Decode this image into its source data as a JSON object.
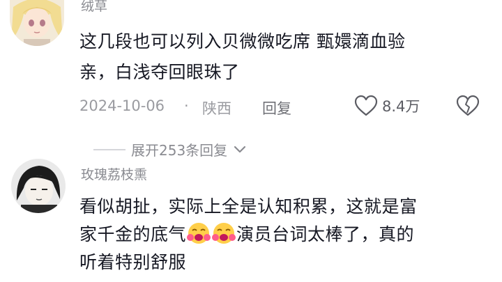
{
  "comment1": {
    "username": "绒草",
    "content_line1": "这几段也可以列入贝微微吃席 甄嬛滴血验",
    "content_line2": "亲，白浅夺回眼珠了",
    "date": "2024-10-06",
    "dot": "·",
    "location": "陕西",
    "reply_label": "回复",
    "like_count": "8.4万"
  },
  "replies": {
    "expand_label": "展开253条回复"
  },
  "comment2": {
    "username": "玫瑰荔枝熏",
    "line1": "看似胡扯，实际上全是认知积累，这就是富",
    "line2_before": "家千金的底气",
    "line2_after": "演员台词太棒了，真的",
    "line3": "听着特别舒服"
  }
}
